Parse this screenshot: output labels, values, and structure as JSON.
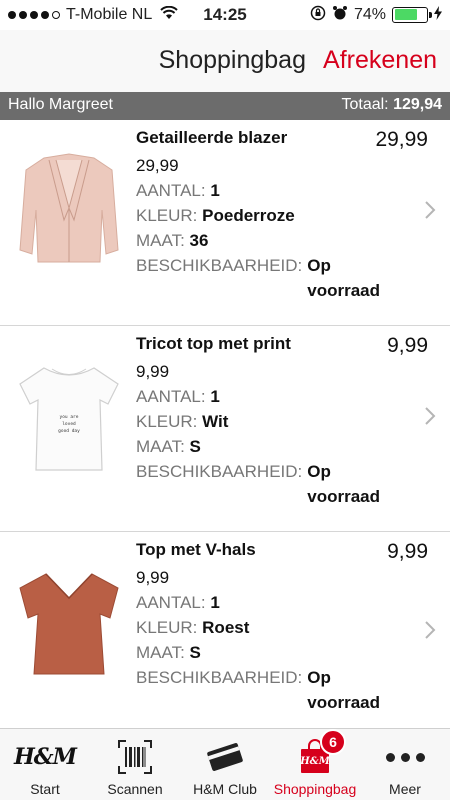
{
  "status_bar": {
    "carrier": "T-Mobile NL",
    "time": "14:25",
    "battery": "74%",
    "battery_level": 0.74,
    "signal_dots_filled": 4
  },
  "header": {
    "title": "Shoppingbag",
    "checkout_label": "Afrekenen",
    "accent_color": "#d6001c"
  },
  "greeting": {
    "name": "Hallo Margreet",
    "total_label": "Totaal:",
    "total_value": "129,94"
  },
  "labels": {
    "quantity": "AANTAL:",
    "color": "KLEUR:",
    "size": "MAAT:",
    "availability": "BESCHIKBAARHEID:"
  },
  "products": [
    {
      "name": "Getailleerde blazer",
      "price": "29,99",
      "line_price": "29,99",
      "quantity": "1",
      "color": "Poederroze",
      "size": "36",
      "availability": "Op voorraad",
      "image_icon": "blazer-image"
    },
    {
      "name": "Tricot top met print",
      "price": "9,99",
      "line_price": "9,99",
      "quantity": "1",
      "color": "Wit",
      "size": "S",
      "availability": "Op voorraad",
      "image_icon": "tshirt-print-image",
      "print_text": [
        "you are",
        "loved",
        "good day"
      ]
    },
    {
      "name": "Top met V-hals",
      "price": "9,99",
      "line_price": "9,99",
      "quantity": "1",
      "color": "Roest",
      "size": "S",
      "availability": "Op voorraad",
      "image_icon": "vneck-top-image"
    }
  ],
  "tabbar": {
    "items": [
      {
        "label": "Start",
        "icon": "hm-logo-icon",
        "logo_text": "H&M"
      },
      {
        "label": "Scannen",
        "icon": "barcode-icon"
      },
      {
        "label": "H&M Club",
        "icon": "card-icon"
      },
      {
        "label": "Shoppingbag",
        "icon": "shopping-bag-icon",
        "badge": "6",
        "logo_text": "H&M"
      },
      {
        "label": "Meer",
        "icon": "more-icon"
      }
    ],
    "active": "Shoppingbag"
  }
}
